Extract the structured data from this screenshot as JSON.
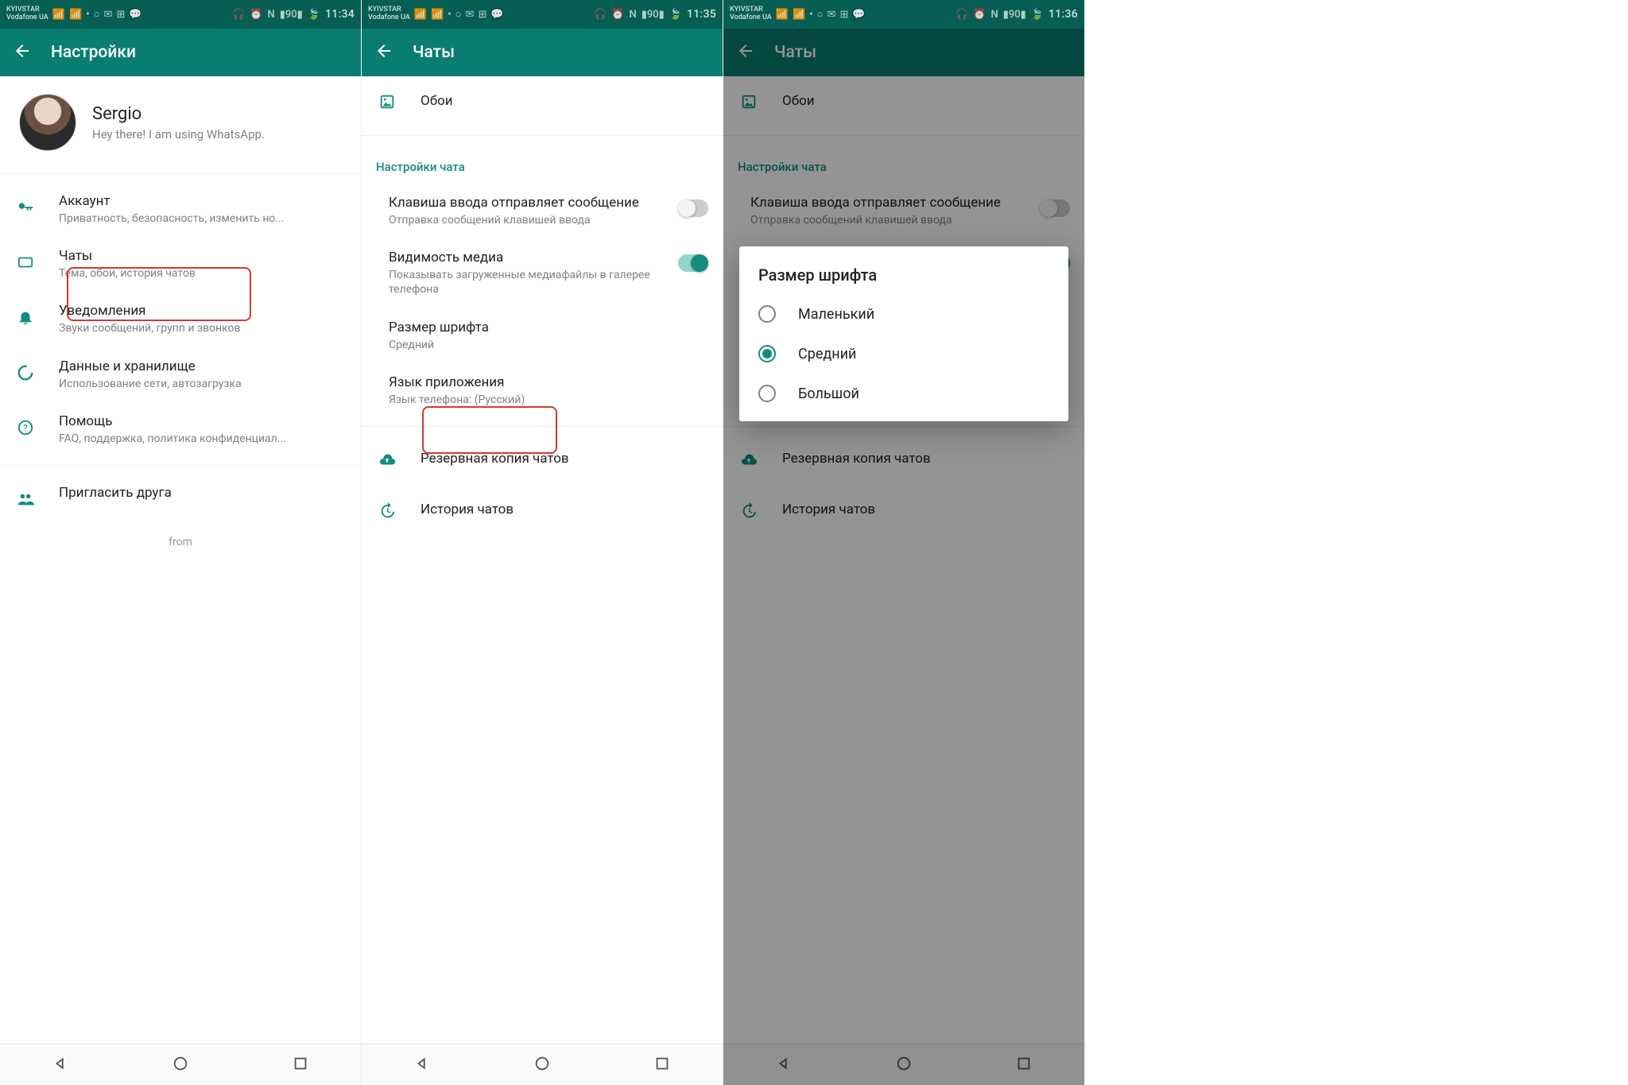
{
  "status": {
    "carrier1": "KYIVSTAR",
    "carrier2": "Vodafone UA",
    "battery": "90",
    "time1": "11:34",
    "time2": "11:35",
    "time3": "11:36"
  },
  "screen1": {
    "title": "Настройки",
    "profile": {
      "name": "Sergio",
      "status": "Hey there! I am using WhatsApp."
    },
    "items": {
      "account": {
        "title": "Аккаунт",
        "sub": "Приватность, безопасность, изменить но..."
      },
      "chats": {
        "title": "Чаты",
        "sub": "Тема, обои, история чатов"
      },
      "notif": {
        "title": "Уведомления",
        "sub": "Звуки сообщений, групп и звонков"
      },
      "data": {
        "title": "Данные и хранилище",
        "sub": "Использование сети, автозагрузка"
      },
      "help": {
        "title": "Помощь",
        "sub": "FAQ, поддержка, политика конфиденциал..."
      },
      "invite": {
        "title": "Пригласить друга"
      }
    },
    "from": "from"
  },
  "screen2": {
    "title": "Чаты",
    "wallpaper": "Обои",
    "section": "Настройки чата",
    "enterSend": {
      "title": "Клавиша ввода отправляет сообщение",
      "sub": "Отправка сообщений клавишей ввода"
    },
    "mediaVis": {
      "title": "Видимость медиа",
      "sub": "Показывать загруженные медиафайлы в галерее телефона"
    },
    "fontSize": {
      "title": "Размер шрифта",
      "sub": "Средний"
    },
    "appLang": {
      "title": "Язык приложения",
      "sub": "Язык телефона: (Русский)"
    },
    "backup": "Резервная копия чатов",
    "history": "История чатов"
  },
  "dialog": {
    "title": "Размер шрифта",
    "opt1": "Маленький",
    "opt2": "Средний",
    "opt3": "Большой"
  }
}
